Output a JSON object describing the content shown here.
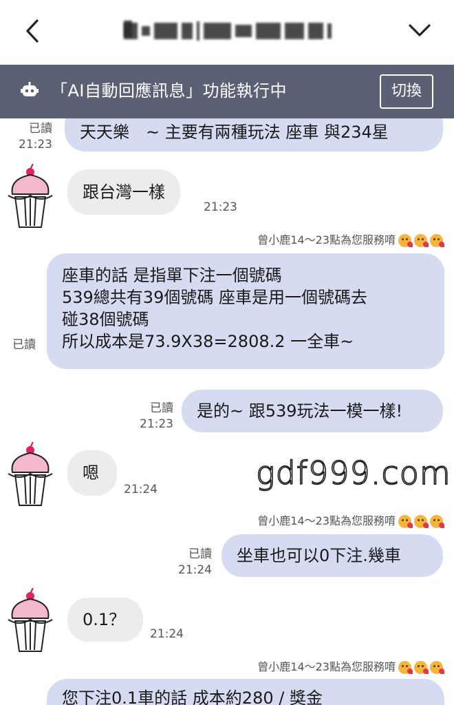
{
  "header": {
    "title": "(blurred contact name)"
  },
  "banner": {
    "text": "「AI自動回應訊息」功能執行中",
    "switch_label": "切換",
    "icon": "robot-icon",
    "bg_color": "#5b6174"
  },
  "colors": {
    "outgoing_bubble": "#d5dcf2",
    "incoming_bubble": "#ececec"
  },
  "messages": [
    {
      "side": "out",
      "text": "天天樂　~ 主要有兩種玩法 座車 與234星",
      "read": "已讀",
      "time": "21:23"
    },
    {
      "side": "in",
      "text": "跟台灣一樣",
      "time": "21:23"
    },
    {
      "side": "out",
      "signature": "曾小鹿14～23點為您服務唷",
      "text": "座車的話 是指單下注一個號碼\n539總共有39個號碼 座車是用一個號碼去\n碰38個號碼\n所以成本是73.9X38=2808.2 一全車~",
      "read": "已讀"
    },
    {
      "side": "out",
      "text": "是的~ 跟539玩法一模一樣!",
      "read": "已讀",
      "time": "21:23"
    },
    {
      "side": "in",
      "text": "嗯",
      "time": "21:24"
    },
    {
      "side": "out",
      "signature": "曾小鹿14～23點為您服務唷",
      "text": "坐車也可以0下注.幾車",
      "read": "已讀",
      "time": "21:24"
    },
    {
      "side": "in",
      "text": "0.1？",
      "time": "21:24"
    },
    {
      "side": "out",
      "signature": "曾小鹿14～23點為您服務唷",
      "text": "您下注0.1車的話 成本約280 / 獎金"
    }
  ],
  "watermark": "gdf999.com"
}
